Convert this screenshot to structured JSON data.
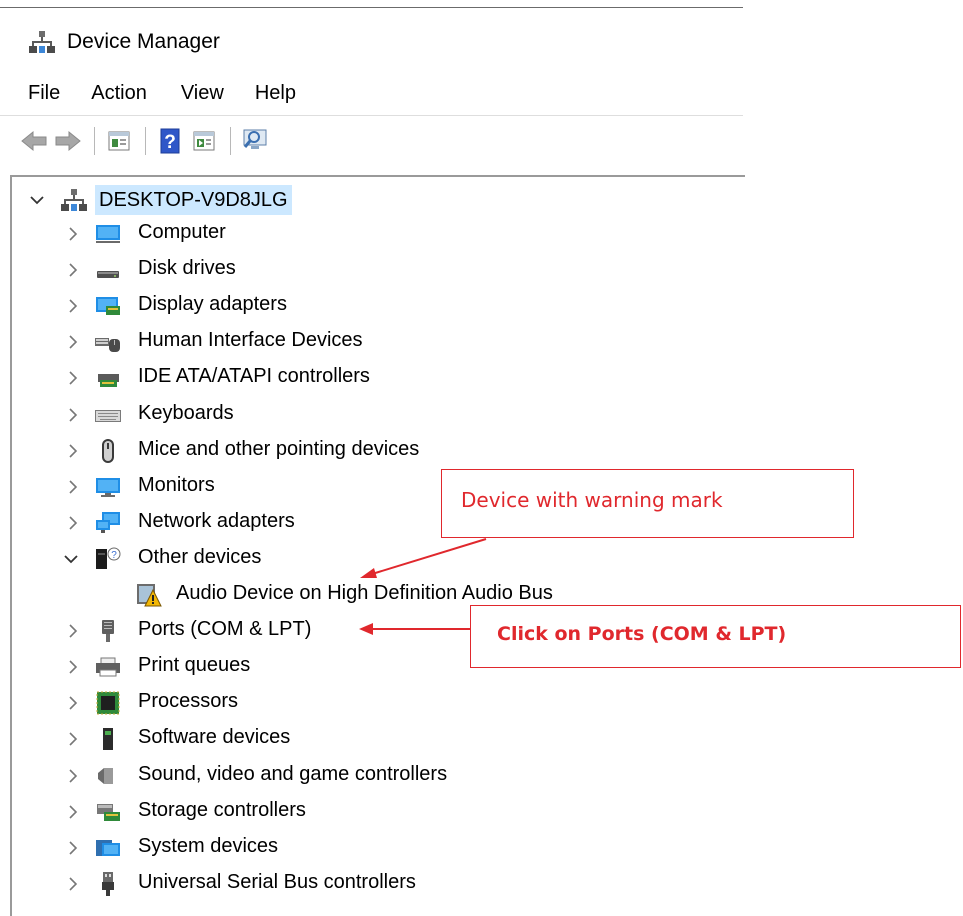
{
  "window": {
    "title": "Device Manager"
  },
  "menu": [
    "File",
    "Action",
    "View",
    "Help"
  ],
  "toolbar": [
    "back-icon",
    "forward-icon",
    "properties-icon",
    "help-icon",
    "run-icon",
    "scan-hardware-icon"
  ],
  "tree": {
    "root": "DESKTOP-V9D8JLG",
    "items": [
      {
        "label": "Computer",
        "icon": "computer-icon",
        "expanded": false
      },
      {
        "label": "Disk drives",
        "icon": "disk-drive-icon",
        "expanded": false
      },
      {
        "label": "Display adapters",
        "icon": "display-adapter-icon",
        "expanded": false
      },
      {
        "label": "Human Interface Devices",
        "icon": "hid-icon",
        "expanded": false
      },
      {
        "label": "IDE ATA/ATAPI controllers",
        "icon": "ide-controller-icon",
        "expanded": false
      },
      {
        "label": "Keyboards",
        "icon": "keyboard-icon",
        "expanded": false
      },
      {
        "label": "Mice and other pointing devices",
        "icon": "mouse-icon",
        "expanded": false
      },
      {
        "label": "Monitors",
        "icon": "monitor-icon",
        "expanded": false
      },
      {
        "label": "Network adapters",
        "icon": "network-adapter-icon",
        "expanded": false
      },
      {
        "label": "Other devices",
        "icon": "unknown-device-icon",
        "expanded": true
      },
      {
        "label": "Audio Device on High Definition Audio Bus",
        "icon": "warning-device-icon",
        "child": true
      },
      {
        "label": "Ports (COM & LPT)",
        "icon": "port-icon",
        "expanded": false
      },
      {
        "label": "Print queues",
        "icon": "printer-icon",
        "expanded": false
      },
      {
        "label": "Processors",
        "icon": "processor-icon",
        "expanded": false
      },
      {
        "label": "Software devices",
        "icon": "software-device-icon",
        "expanded": false
      },
      {
        "label": "Sound, video and game controllers",
        "icon": "speaker-icon",
        "expanded": false
      },
      {
        "label": "Storage controllers",
        "icon": "storage-controller-icon",
        "expanded": false
      },
      {
        "label": "System devices",
        "icon": "system-device-icon",
        "expanded": false
      },
      {
        "label": "Universal Serial Bus controllers",
        "icon": "usb-icon",
        "expanded": false
      }
    ]
  },
  "annotations": {
    "warning_callout": "Device with warning mark",
    "ports_callout": "Click on  Ports (COM & LPT)"
  },
  "colors": {
    "annotation": "#e0282d",
    "selection": "#cce8ff",
    "warning": "#f2b705"
  }
}
